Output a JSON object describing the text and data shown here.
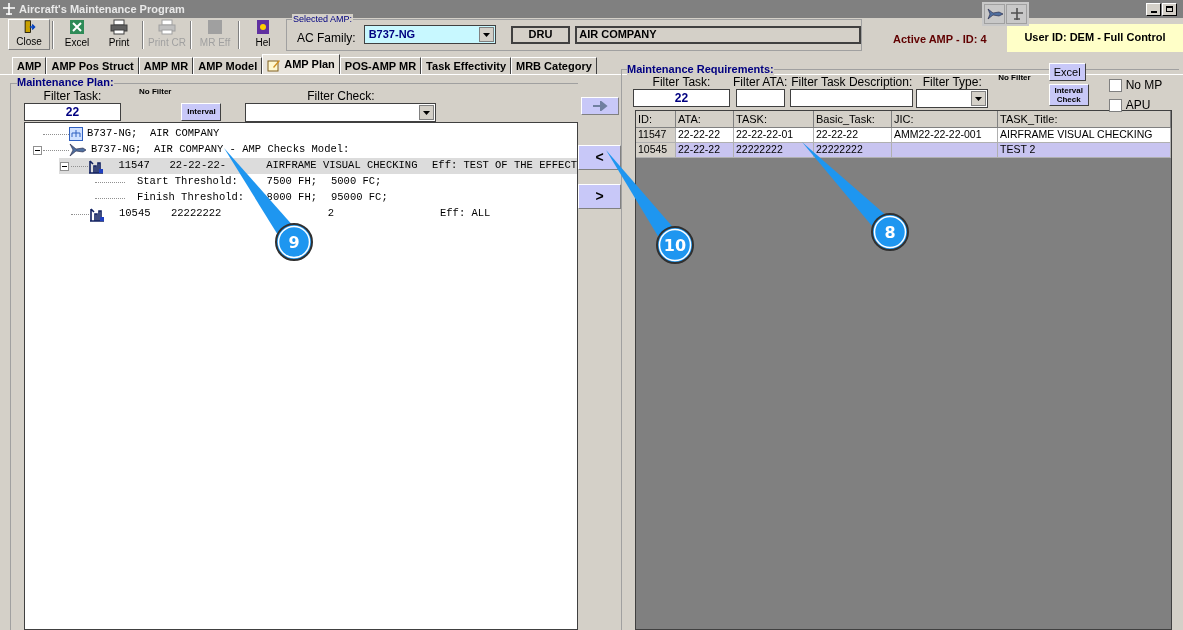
{
  "window": {
    "title": "Aircraft's Maintenance Program"
  },
  "toolbar": [
    {
      "label": "Close",
      "kind": "close",
      "disabled": false,
      "selected": true
    },
    {
      "label": "Excel",
      "kind": "excel",
      "disabled": false,
      "selected": false
    },
    {
      "label": "Print",
      "kind": "print",
      "disabled": false,
      "selected": false
    },
    {
      "label": "Print CR",
      "kind": "print",
      "disabled": true,
      "selected": false
    },
    {
      "label": "MR Eff",
      "kind": "square",
      "disabled": true,
      "selected": false
    },
    {
      "label": "Hel",
      "kind": "help",
      "disabled": false,
      "selected": false
    }
  ],
  "selected_amp": {
    "legend": "Selected AMP:",
    "ac_family_label": "AC Family:",
    "ac_family": "B737-NG",
    "code": "DRU",
    "company": "AIR COMPANY"
  },
  "active_amp": "Active AMP - ID: 4",
  "user": "User ID: DEM - Full Control",
  "tabs": [
    {
      "label": "AMP",
      "selected": false
    },
    {
      "label": "AMP Pos Struct",
      "selected": false
    },
    {
      "label": "AMP MR",
      "selected": false
    },
    {
      "label": "AMP Model",
      "selected": false
    },
    {
      "label": "AMP Plan",
      "selected": true
    },
    {
      "label": "POS-AMP MR",
      "selected": false
    },
    {
      "label": "Task Effectivity",
      "selected": false
    },
    {
      "label": "MRB Category",
      "selected": false
    }
  ],
  "plan": {
    "title": "Maintenance Plan:",
    "filter_task_label": "Filter Task:",
    "filter_task": "22",
    "no_filter": "No Filter",
    "interval_button": "Interval",
    "filter_check_label": "Filter Check:",
    "tree": [
      {
        "kind": "company",
        "text": "B737-NG;  AIR COMPANY",
        "selected": false
      },
      {
        "kind": "model",
        "text": "B737-NG;  AIR COMPANY - AMP Checks Model:",
        "expanded": true,
        "selected": false,
        "children": [
          {
            "kind": "task",
            "id": "11547",
            "task": "22-22-22-",
            "title": "AIRFRAME VISUAL CHECKING",
            "eff": "Eff: TEST OF THE EFFECT",
            "expanded": true,
            "selected": true,
            "children": [
              {
                "kind": "threshold",
                "label": "Start Threshold:",
                "fh": "7500 FH;",
                "fc": "5000 FC;"
              },
              {
                "kind": "threshold",
                "label": "Finish Threshold:",
                "fh": "8000 FH;",
                "fc": "95000 FC;"
              }
            ]
          },
          {
            "kind": "task",
            "id": "10545",
            "task": "22222222",
            "title": "2",
            "eff": "Eff: ALL",
            "selected": false
          }
        ]
      }
    ]
  },
  "middle_buttons": [
    {
      "label": "<"
    },
    {
      "label": ">"
    }
  ],
  "requirements": {
    "title": "Maintenance Requirements:",
    "filters": [
      {
        "label": "Filter Task:",
        "value": "22"
      },
      {
        "label": "Filter ATA:"
      },
      {
        "label": "Filter Task Description:"
      }
    ],
    "filter_type_label": "Filter Type:",
    "no_filter": "No Filter",
    "excel_button": "Excel",
    "interval_button": [
      "Interval",
      "Check"
    ],
    "checkboxes": [
      {
        "label": "No MP",
        "checked": false
      },
      {
        "label": "APU",
        "checked": false
      }
    ],
    "table": {
      "columns": [
        "ID:",
        "ATA:",
        "TASK:",
        "Basic_Task:",
        "JIC:",
        "TASK_Title:"
      ],
      "rows": [
        {
          "cells": [
            "11547",
            "22-22-22",
            "22-22-22-01",
            "22-22-22",
            "AMM22-22-22-001",
            "AIRFRAME VISUAL CHECKING"
          ],
          "selected": false
        },
        {
          "cells": [
            "10545",
            "22-22-22",
            "22222222",
            "22222222",
            "",
            "TEST 2"
          ],
          "selected": true
        }
      ]
    }
  },
  "callouts": [
    "9",
    "10",
    "8"
  ]
}
